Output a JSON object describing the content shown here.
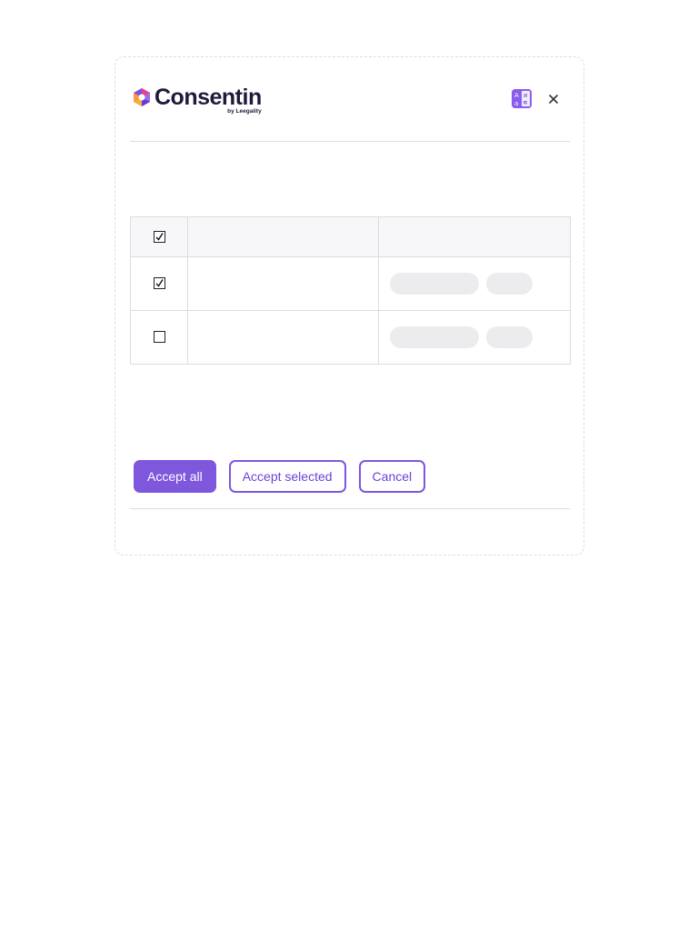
{
  "app": {
    "brand_name": "Consentin",
    "brand_sub": "by Leegality"
  },
  "colors": {
    "accent": "#7e57dd",
    "accent_text": "#6a42d6",
    "brand_dark": "#1e1b3a"
  },
  "header": {
    "language_icon": "translate-icon",
    "close_icon": "close-icon",
    "close_glyph": "✕"
  },
  "table": {
    "header": {
      "checked": true
    },
    "rows": [
      {
        "checked": true
      },
      {
        "checked": false
      }
    ]
  },
  "actions": {
    "accept_all_label": "Accept all",
    "accept_selected_label": "Accept selected",
    "cancel_label": "Cancel"
  }
}
